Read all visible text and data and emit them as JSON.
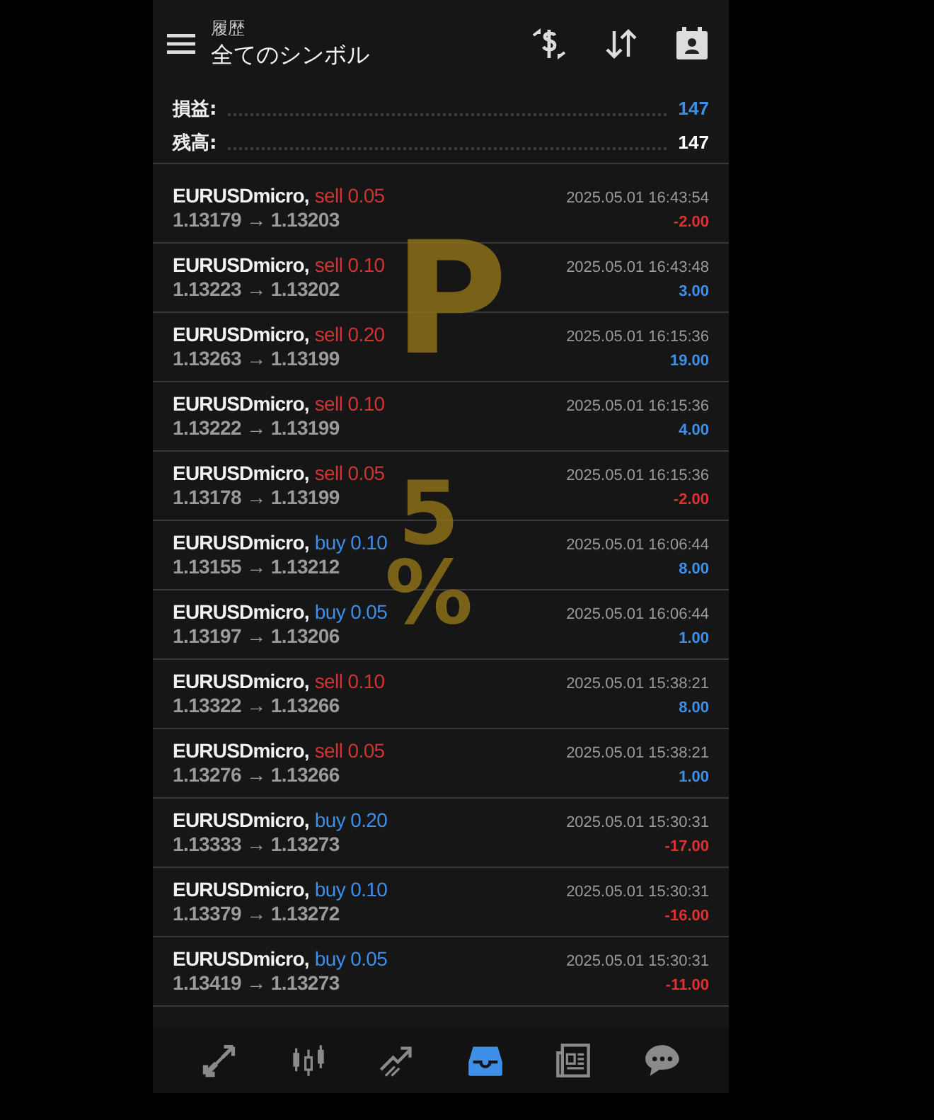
{
  "header": {
    "subtitle": "履歴",
    "title": "全てのシンボル"
  },
  "summary": [
    {
      "label": "損益:",
      "value": "147",
      "kind": "profit"
    },
    {
      "label": "残高:",
      "value": "147",
      "kind": "balance"
    }
  ],
  "deals": [
    {
      "symbol": "EURUSDmicro,",
      "order": "sell 0.05",
      "kind": "sell",
      "prices": "1.13179 → 1.13203",
      "time": "2025.05.01 16:43:54",
      "profit": "-2.00",
      "color": "#e03030"
    },
    {
      "symbol": "EURUSDmicro,",
      "order": "sell 0.10",
      "kind": "sell",
      "prices": "1.13223 → 1.13202",
      "time": "2025.05.01 16:43:48",
      "profit": "3.00",
      "color": "#3d8fe8"
    },
    {
      "symbol": "EURUSDmicro,",
      "order": "sell 0.20",
      "kind": "sell",
      "prices": "1.13263 → 1.13199",
      "time": "2025.05.01 16:15:36",
      "profit": "19.00",
      "color": "#3d8fe8"
    },
    {
      "symbol": "EURUSDmicro,",
      "order": "sell 0.10",
      "kind": "sell",
      "prices": "1.13222 → 1.13199",
      "time": "2025.05.01 16:15:36",
      "profit": "4.00",
      "color": "#3d8fe8"
    },
    {
      "symbol": "EURUSDmicro,",
      "order": "sell 0.05",
      "kind": "sell",
      "prices": "1.13178 → 1.13199",
      "time": "2025.05.01 16:15:36",
      "profit": "-2.00",
      "color": "#e03030"
    },
    {
      "symbol": "EURUSDmicro,",
      "order": "buy 0.10",
      "kind": "buy",
      "prices": "1.13155 → 1.13212",
      "time": "2025.05.01 16:06:44",
      "profit": "8.00",
      "color": "#3d8fe8"
    },
    {
      "symbol": "EURUSDmicro,",
      "order": "buy 0.05",
      "kind": "buy",
      "prices": "1.13197 → 1.13206",
      "time": "2025.05.01 16:06:44",
      "profit": "1.00",
      "color": "#3d8fe8"
    },
    {
      "symbol": "EURUSDmicro,",
      "order": "sell 0.10",
      "kind": "sell",
      "prices": "1.13322 → 1.13266",
      "time": "2025.05.01 15:38:21",
      "profit": "8.00",
      "color": "#3d8fe8"
    },
    {
      "symbol": "EURUSDmicro,",
      "order": "sell 0.05",
      "kind": "sell",
      "prices": "1.13276 → 1.13266",
      "time": "2025.05.01 15:38:21",
      "profit": "1.00",
      "color": "#3d8fe8"
    },
    {
      "symbol": "EURUSDmicro,",
      "order": "buy 0.20",
      "kind": "buy",
      "prices": "1.13333 → 1.13273",
      "time": "2025.05.01 15:30:31",
      "profit": "-17.00",
      "color": "#e03030"
    },
    {
      "symbol": "EURUSDmicro,",
      "order": "buy 0.10",
      "kind": "buy",
      "prices": "1.13379 → 1.13272",
      "time": "2025.05.01 15:30:31",
      "profit": "-16.00",
      "color": "#e03030"
    },
    {
      "symbol": "EURUSDmicro,",
      "order": "buy 0.05",
      "kind": "buy",
      "prices": "1.13419 → 1.13273",
      "time": "2025.05.01 15:30:31",
      "profit": "-11.00",
      "color": "#e03030"
    }
  ],
  "annotation": [
    "P",
    "5%"
  ],
  "nav": [
    {
      "kind": "quotes",
      "selected": false
    },
    {
      "kind": "chart",
      "selected": false
    },
    {
      "kind": "trade",
      "selected": false
    },
    {
      "kind": "history",
      "selected": true
    },
    {
      "kind": "news",
      "selected": false
    },
    {
      "kind": "chat",
      "selected": false
    }
  ]
}
